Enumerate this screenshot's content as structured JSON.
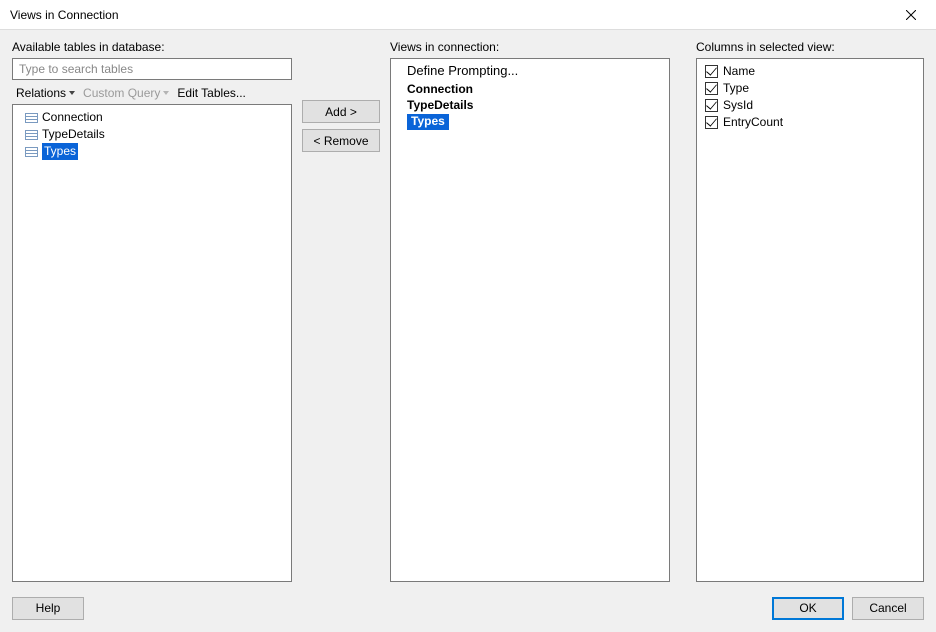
{
  "window": {
    "title": "Views in Connection"
  },
  "labels": {
    "available": "Available tables in database:",
    "views": "Views in connection:",
    "columns": "Columns in selected view:",
    "define_prompting": "Define Prompting..."
  },
  "search": {
    "placeholder": "Type to search tables"
  },
  "toolbar": {
    "relations": "Relations",
    "custom_query": "Custom Query",
    "edit_tables": "Edit Tables..."
  },
  "available_tables": [
    {
      "name": "Connection",
      "selected": false
    },
    {
      "name": "TypeDetails",
      "selected": false
    },
    {
      "name": "Types",
      "selected": true
    }
  ],
  "buttons": {
    "add": "Add >",
    "remove": "< Remove"
  },
  "views_list": [
    {
      "name": "Connection",
      "selected": false
    },
    {
      "name": "TypeDetails",
      "selected": false
    },
    {
      "name": "Types",
      "selected": true
    }
  ],
  "columns_list": [
    {
      "name": "Name",
      "checked": true
    },
    {
      "name": "Type",
      "checked": true
    },
    {
      "name": "SysId",
      "checked": true
    },
    {
      "name": "EntryCount",
      "checked": true
    }
  ],
  "footer": {
    "help": "Help",
    "ok": "OK",
    "cancel": "Cancel"
  }
}
